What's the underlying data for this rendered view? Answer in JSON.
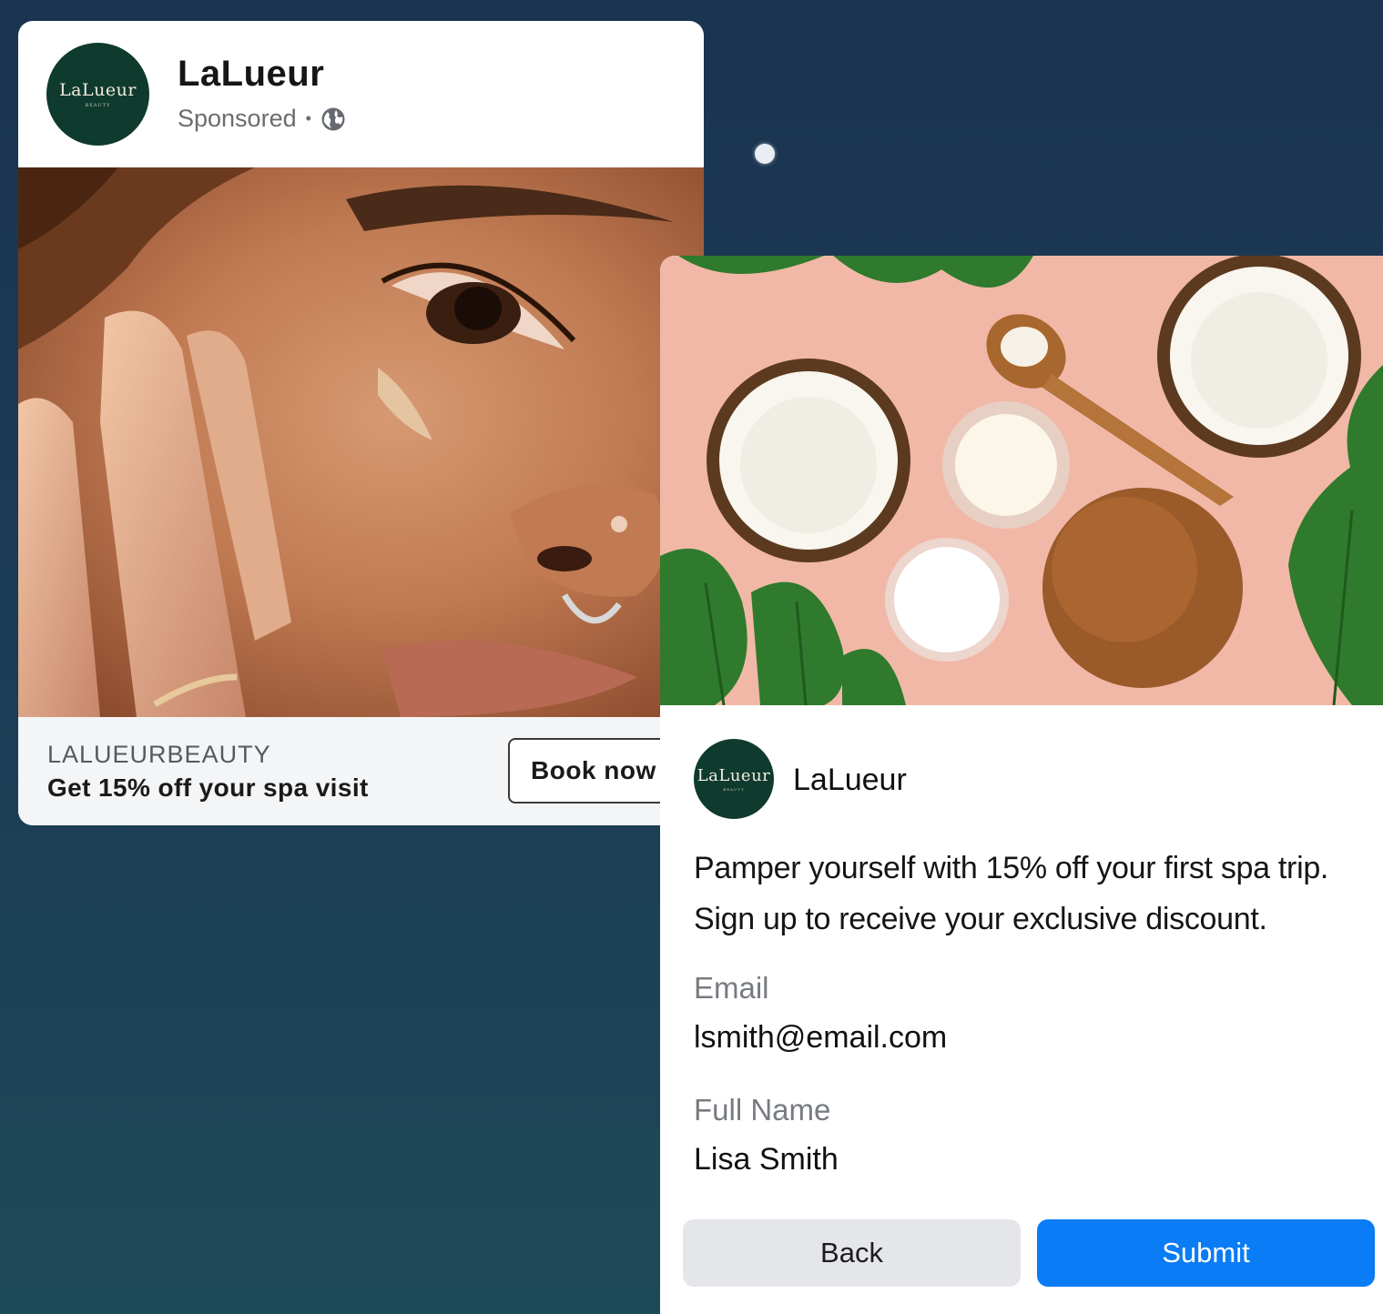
{
  "ad": {
    "logo_wordmark": "LaLueur",
    "logo_subtext": "BEAUTY",
    "brand_name": "LaLueur",
    "sponsored_label": "Sponsored",
    "separator": "•",
    "audience_icon": "globe-icon",
    "image_subject": "close-up of woman applying skincare cream to cheek",
    "handle": "LALUEURBEAUTY",
    "offer": "Get 15% off your spa visit",
    "cta_label": "Book now"
  },
  "form": {
    "image_subject": "halved coconuts, cream jars and wooden spoon on pink background with monstera leaves",
    "logo_wordmark": "LaLueur",
    "logo_subtext": "BEAUTY",
    "brand_name": "LaLueur",
    "intro_line1": "Pamper yourself with 15% off your first spa trip.",
    "intro_line2": "Sign up to receive your exclusive discount.",
    "email_label": "Email",
    "email_value": "lsmith@email.com",
    "name_label": "Full Name",
    "name_value": "Lisa Smith",
    "back_label": "Back",
    "submit_label": "Submit"
  },
  "colors": {
    "background": "#1c3a55",
    "logo_green": "#0f3a2e",
    "submit_blue": "#0a7cf5",
    "back_gray": "#e4e6e9",
    "form_image_pink": "#f1b8a7"
  }
}
